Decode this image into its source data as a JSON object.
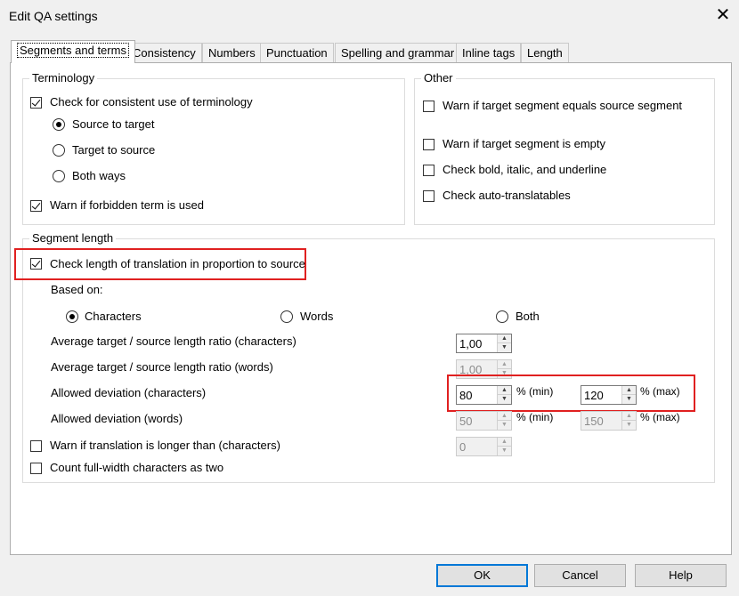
{
  "window": {
    "title": "Edit QA settings",
    "close_glyph": "✕"
  },
  "tabs": [
    {
      "label": "Segments and terms"
    },
    {
      "label": "Consistency"
    },
    {
      "label": "Numbers"
    },
    {
      "label": "Punctuation"
    },
    {
      "label": "Spelling and grammar"
    },
    {
      "label": "Inline tags"
    },
    {
      "label": "Length"
    }
  ],
  "terminology": {
    "title": "Terminology",
    "check_consistent": {
      "label": "Check for consistent use of terminology",
      "checked": true
    },
    "directions": [
      {
        "label": "Source to target",
        "selected": true
      },
      {
        "label": "Target to source",
        "selected": false
      },
      {
        "label": "Both ways",
        "selected": false
      }
    ],
    "warn_forbidden": {
      "label": "Warn if forbidden term is used",
      "checked": true
    }
  },
  "other": {
    "title": "Other",
    "items": [
      {
        "label": "Warn if target segment equals source segment",
        "checked": false
      },
      {
        "label": "Warn if target segment is empty",
        "checked": false
      },
      {
        "label": "Check bold, italic, and underline",
        "checked": false
      },
      {
        "label": "Check auto-translatables",
        "checked": false
      }
    ]
  },
  "segment_length": {
    "title": "Segment length",
    "check_length": {
      "label": "Check length of translation in proportion to source",
      "checked": true
    },
    "based_on_label": "Based on:",
    "based_on": [
      {
        "label": "Characters",
        "selected": true
      },
      {
        "label": "Words",
        "selected": false
      },
      {
        "label": "Both",
        "selected": false
      }
    ],
    "avg_chars": {
      "label": "Average target / source length ratio (characters)",
      "value": "1,00"
    },
    "avg_words": {
      "label": "Average target / source length ratio (words)",
      "value": "1,00"
    },
    "dev_chars": {
      "label": "Allowed deviation (characters)",
      "min": "80",
      "max": "120",
      "min_suffix": "% (min)",
      "max_suffix": "% (max)"
    },
    "dev_words": {
      "label": "Allowed deviation (words)",
      "min": "50",
      "max": "150",
      "min_suffix": "% (min)",
      "max_suffix": "% (max)"
    },
    "warn_longer": {
      "label": "Warn if translation is longer than (characters)",
      "checked": false,
      "value": "0"
    },
    "full_width": {
      "label": "Count full-width characters as two",
      "checked": false
    }
  },
  "buttons": {
    "ok": "OK",
    "cancel": "Cancel",
    "help": "Help"
  },
  "colors": {
    "highlight": "#e02020",
    "default_button_border": "#0078d7"
  }
}
